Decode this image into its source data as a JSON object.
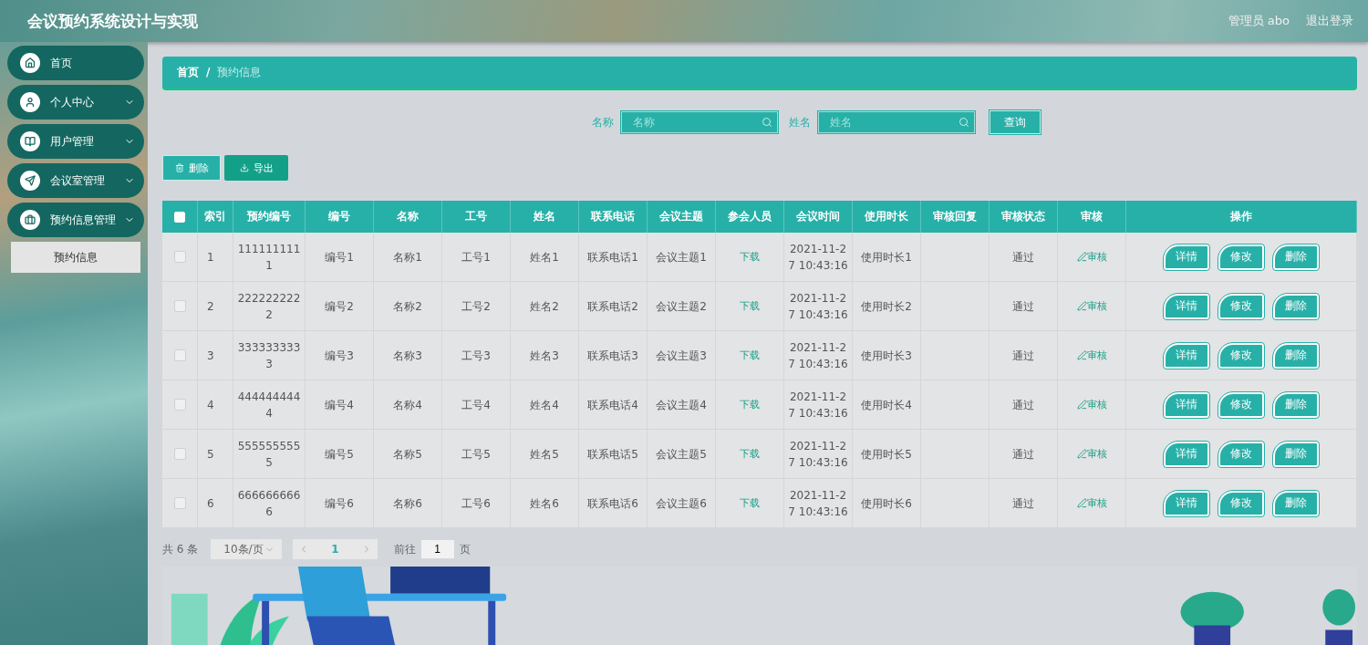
{
  "header": {
    "title": "会议预约系统设计与实现",
    "user": "管理员 abo",
    "logout": "退出登录"
  },
  "sidebar": {
    "items": [
      {
        "label": "首页",
        "submenu": false
      },
      {
        "label": "个人中心",
        "submenu": true
      },
      {
        "label": "用户管理",
        "submenu": true
      },
      {
        "label": "会议室管理",
        "submenu": true
      },
      {
        "label": "预约信息管理",
        "submenu": true,
        "children": [
          {
            "label": "预约信息",
            "selected": true
          }
        ]
      }
    ]
  },
  "breadcrumb": [
    {
      "label": "首页",
      "current": false
    },
    {
      "separator": "/"
    },
    {
      "label": "预约信息",
      "current": true
    }
  ],
  "search": [
    {
      "label": "名称",
      "placeholder": "名称"
    },
    {
      "label": "姓名",
      "placeholder": "姓名"
    }
  ],
  "search_button": "查询",
  "actions": [
    {
      "label": "删除",
      "kind": "delete"
    },
    {
      "label": "导出",
      "kind": "export"
    }
  ],
  "table": {
    "all_checked": false,
    "columns": [
      "索引",
      "预约编号",
      "编号",
      "名称",
      "工号",
      "姓名",
      "联系电话",
      "会议主题",
      "参会人员",
      "会议时间",
      "使用时长",
      "审核回复",
      "审核状态",
      "审核",
      "操作"
    ],
    "rows": [
      {
        "checked": false,
        "index": "1",
        "booking_no": "1111111111",
        "no": "编号1",
        "name": "名称1",
        "staff_no": "工号1",
        "person": "姓名1",
        "phone": "联系电话1",
        "topic": "会议主题1",
        "attendees": "下载",
        "time": "2021-11-27 10:43:16",
        "duration": "使用时长1",
        "status": "通过",
        "review": "审核",
        "ops": [
          "详情",
          "修改",
          "删除"
        ]
      },
      {
        "checked": false,
        "index": "2",
        "booking_no": "2222222222",
        "no": "编号2",
        "name": "名称2",
        "staff_no": "工号2",
        "person": "姓名2",
        "phone": "联系电话2",
        "topic": "会议主题2",
        "attendees": "下载",
        "time": "2021-11-27 10:43:16",
        "duration": "使用时长2",
        "status": "通过",
        "review": "审核",
        "ops": [
          "详情",
          "修改",
          "删除"
        ]
      },
      {
        "checked": false,
        "index": "3",
        "booking_no": "3333333333",
        "no": "编号3",
        "name": "名称3",
        "staff_no": "工号3",
        "person": "姓名3",
        "phone": "联系电话3",
        "topic": "会议主题3",
        "attendees": "下载",
        "time": "2021-11-27 10:43:16",
        "duration": "使用时长3",
        "status": "通过",
        "review": "审核",
        "ops": [
          "详情",
          "修改",
          "删除"
        ]
      },
      {
        "checked": false,
        "index": "4",
        "booking_no": "4444444444",
        "no": "编号4",
        "name": "名称4",
        "staff_no": "工号4",
        "person": "姓名4",
        "phone": "联系电话4",
        "topic": "会议主题4",
        "attendees": "下载",
        "time": "2021-11-27 10:43:16",
        "duration": "使用时长4",
        "status": "通过",
        "review": "审核",
        "ops": [
          "详情",
          "修改",
          "删除"
        ]
      },
      {
        "checked": false,
        "index": "5",
        "booking_no": "5555555555",
        "no": "编号5",
        "name": "名称5",
        "staff_no": "工号5",
        "person": "姓名5",
        "phone": "联系电话5",
        "topic": "会议主题5",
        "attendees": "下载",
        "time": "2021-11-27 10:43:16",
        "duration": "使用时长5",
        "status": "通过",
        "review": "审核",
        "ops": [
          "详情",
          "修改",
          "删除"
        ]
      },
      {
        "checked": false,
        "index": "6",
        "booking_no": "6666666666",
        "no": "编号6",
        "name": "名称6",
        "staff_no": "工号6",
        "person": "姓名6",
        "phone": "联系电话6",
        "topic": "会议主题6",
        "attendees": "下载",
        "time": "2021-11-27 10:43:16",
        "duration": "使用时长6",
        "status": "通过",
        "review": "审核",
        "ops": [
          "详情",
          "修改",
          "删除"
        ]
      }
    ]
  },
  "pagination": {
    "total": "共 6 条",
    "page_size": "10条/页",
    "pages": [
      {
        "label": "1",
        "selected": true
      }
    ],
    "goto_label": "前往",
    "goto_value": "1",
    "goto_suffix": "页"
  }
}
